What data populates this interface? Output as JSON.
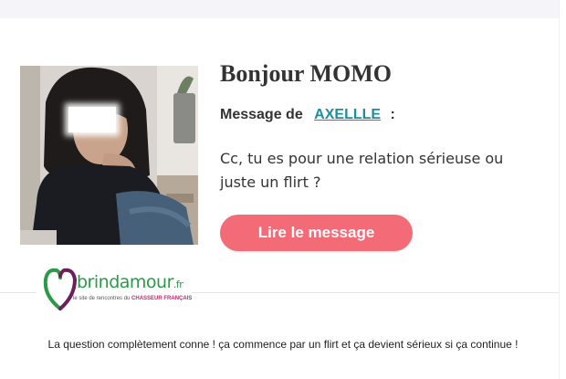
{
  "email": {
    "greeting": "Bonjour MOMO",
    "from_prefix": "Message de",
    "sender_name": "AXELLLE",
    "from_suffix": ":",
    "message": "Cc, tu es pour une relation sérieuse ou juste un flirt ?",
    "cta_label": "Lire le message"
  },
  "logo": {
    "name": "brindamour",
    "tld": ".fr",
    "tagline_prefix": "le site de rencontres du",
    "tagline_brand": "CHASSEUR FRANÇAIS"
  },
  "footer": {
    "text": "La question complètement conne ! ça commence par un flirt et ça devient sérieux si ça continue !"
  },
  "colors": {
    "cta": "#f26b76",
    "link": "#1a8fa0",
    "logo_green": "#2a9a49",
    "logo_pink": "#c8256e"
  }
}
